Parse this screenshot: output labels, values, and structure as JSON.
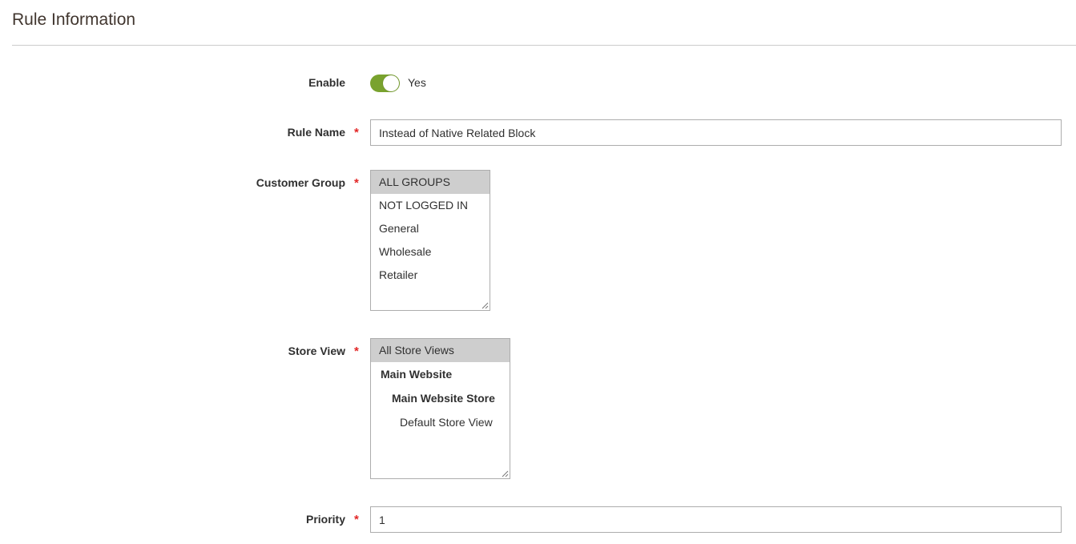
{
  "section": {
    "title": "Rule Information"
  },
  "fields": {
    "enable": {
      "label": "Enable",
      "value_text": "Yes",
      "checked": true
    },
    "rule_name": {
      "label": "Rule Name",
      "required_mark": "*",
      "value": "Instead of Native Related Block"
    },
    "customer_group": {
      "label": "Customer Group",
      "required_mark": "*",
      "options": [
        {
          "label": "ALL GROUPS",
          "selected": true
        },
        {
          "label": "NOT LOGGED IN",
          "selected": false
        },
        {
          "label": "General",
          "selected": false
        },
        {
          "label": "Wholesale",
          "selected": false
        },
        {
          "label": "Retailer",
          "selected": false
        }
      ]
    },
    "store_view": {
      "label": "Store View",
      "required_mark": "*",
      "all_option": "All Store Views",
      "website_group": "Main Website",
      "store_group": "Main Website Store",
      "store_view_option": "Default Store View"
    },
    "priority": {
      "label": "Priority",
      "required_mark": "*",
      "value": "1"
    }
  },
  "colors": {
    "toggle_on": "#79a22e",
    "required": "#e22626",
    "selected_option_bg": "#cecece",
    "input_border": "#adadad"
  },
  "icons": {
    "resize_grip": "resize-grip-icon"
  }
}
